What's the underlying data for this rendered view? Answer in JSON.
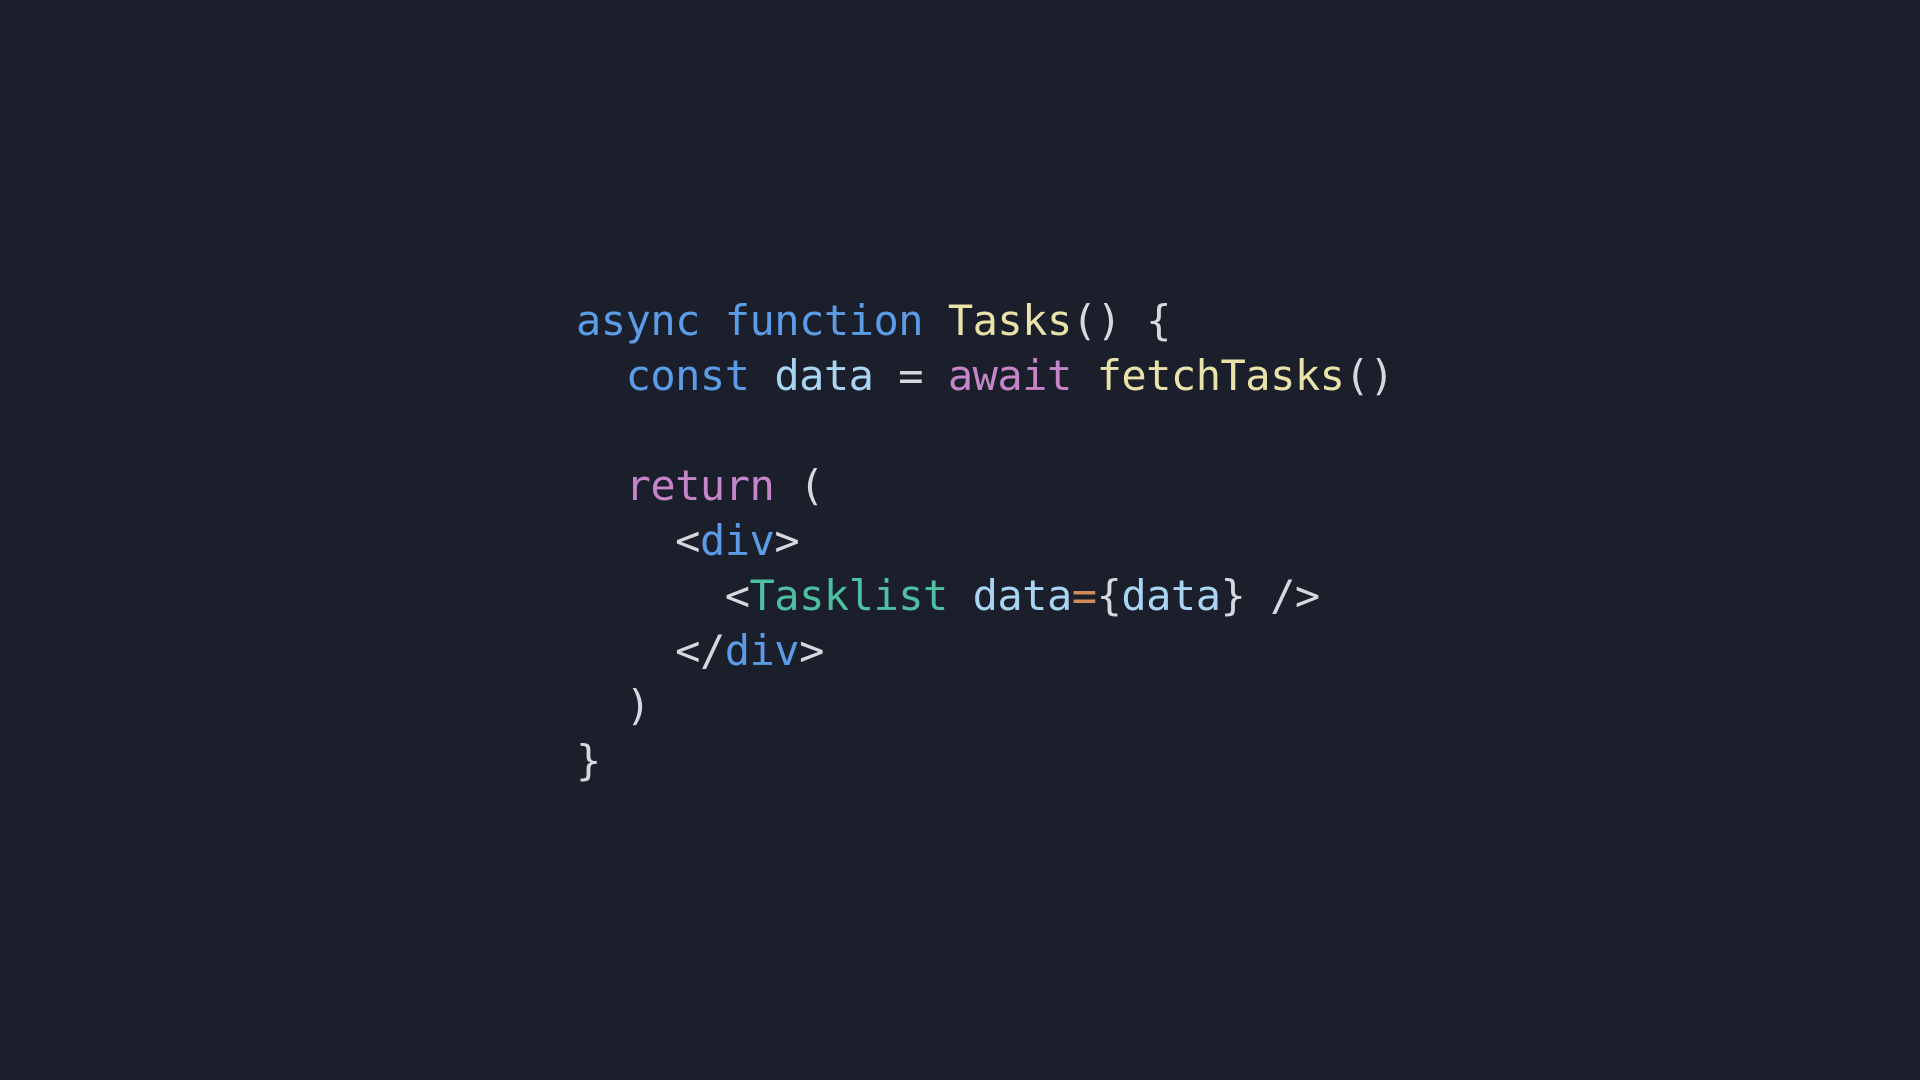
{
  "editor": {
    "background": "#1b1f2b",
    "colors": {
      "keyword": "#5c9ce6",
      "control_keyword": "#c585c8",
      "function_name": "#e9e3a9",
      "variable": "#a9d4f2",
      "jsx_tag": "#5c9ce6",
      "component": "#4fbfa3",
      "operator": "#d28a5a",
      "punctuation": "#d6d8de"
    },
    "lines": [
      {
        "indent": "",
        "tokens": [
          {
            "text": "async",
            "type": "keyword"
          },
          {
            "text": " ",
            "type": "space"
          },
          {
            "text": "function",
            "type": "keyword"
          },
          {
            "text": " ",
            "type": "space"
          },
          {
            "text": "Tasks",
            "type": "function_name"
          },
          {
            "text": "() {",
            "type": "punctuation"
          }
        ]
      },
      {
        "indent": "  ",
        "tokens": [
          {
            "text": "const",
            "type": "keyword"
          },
          {
            "text": " ",
            "type": "space"
          },
          {
            "text": "data",
            "type": "variable"
          },
          {
            "text": " = ",
            "type": "punctuation"
          },
          {
            "text": "await",
            "type": "control_keyword"
          },
          {
            "text": " ",
            "type": "space"
          },
          {
            "text": "fetchTasks",
            "type": "function_name"
          },
          {
            "text": "()",
            "type": "punctuation"
          }
        ]
      },
      {
        "indent": "",
        "tokens": []
      },
      {
        "indent": "  ",
        "tokens": [
          {
            "text": "return",
            "type": "control_keyword"
          },
          {
            "text": " (",
            "type": "punctuation"
          }
        ]
      },
      {
        "indent": "    ",
        "tokens": [
          {
            "text": "<",
            "type": "punctuation"
          },
          {
            "text": "div",
            "type": "jsx_tag"
          },
          {
            "text": ">",
            "type": "punctuation"
          }
        ]
      },
      {
        "indent": "      ",
        "tokens": [
          {
            "text": "<",
            "type": "punctuation"
          },
          {
            "text": "Tasklist",
            "type": "component"
          },
          {
            "text": " ",
            "type": "space"
          },
          {
            "text": "data",
            "type": "variable"
          },
          {
            "text": "=",
            "type": "operator"
          },
          {
            "text": "{",
            "type": "punctuation"
          },
          {
            "text": "data",
            "type": "variable"
          },
          {
            "text": "} />",
            "type": "punctuation"
          }
        ]
      },
      {
        "indent": "    ",
        "tokens": [
          {
            "text": "</",
            "type": "punctuation"
          },
          {
            "text": "div",
            "type": "jsx_tag"
          },
          {
            "text": ">",
            "type": "punctuation"
          }
        ]
      },
      {
        "indent": "  ",
        "tokens": [
          {
            "text": ")",
            "type": "punctuation"
          }
        ]
      },
      {
        "indent": "",
        "tokens": [
          {
            "text": "}",
            "type": "punctuation"
          }
        ]
      }
    ]
  }
}
